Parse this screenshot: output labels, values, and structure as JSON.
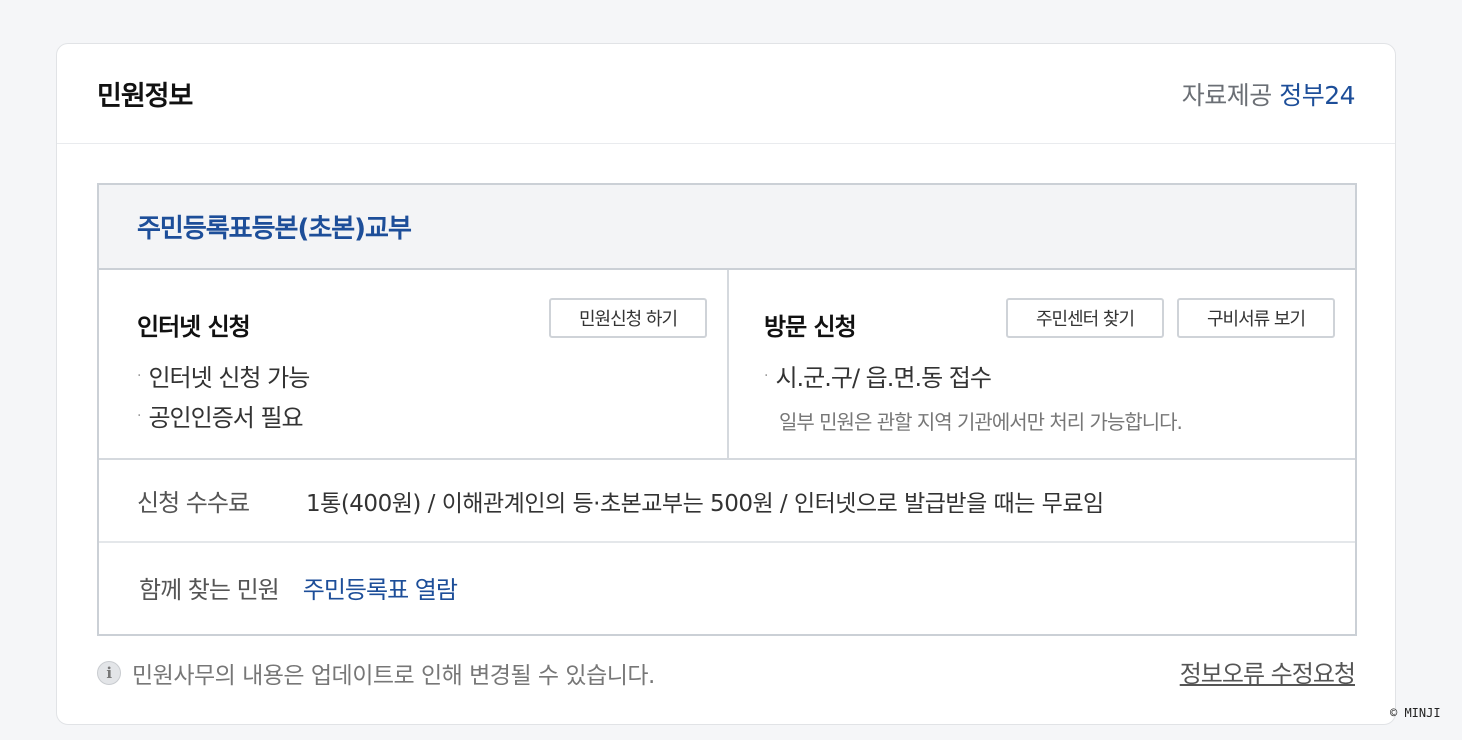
{
  "header": {
    "title": "민원정보",
    "provider_label": "자료제공",
    "provider_name": "정부24"
  },
  "service": {
    "name": "주민등록표등본(초본)교부"
  },
  "internet_apply": {
    "title": "인터넷 신청",
    "button_label": "민원신청 하기",
    "items": [
      "인터넷 신청 가능",
      "공인인증서 필요"
    ]
  },
  "visit_apply": {
    "title": "방문 신청",
    "buttons": [
      "주민센터 찾기",
      "구비서류 보기"
    ],
    "items": [
      "시.군.구/ 읍.면.동 접수"
    ],
    "note": "일부 민원은 관할 지역 기관에서만 처리 가능합니다."
  },
  "fee": {
    "label": "신청 수수료",
    "value": "1통(400원) / 이해관계인의 등·초본교부는 500원 / 인터넷으로 발급받을 때는 무료임"
  },
  "related": {
    "label": "함께 찾는 민원",
    "link": "주민등록표 열람"
  },
  "footer": {
    "info_icon_glyph": "i",
    "note": "민원사무의 내용은 업데이트로 인해 변경될 수 있습니다.",
    "report_link": "정보오류 수정요청"
  },
  "copyright": "© MINJI",
  "colors": {
    "accent": "#1d4e99",
    "border": "#cbd0d6",
    "title_bg": "#f3f4f6"
  }
}
